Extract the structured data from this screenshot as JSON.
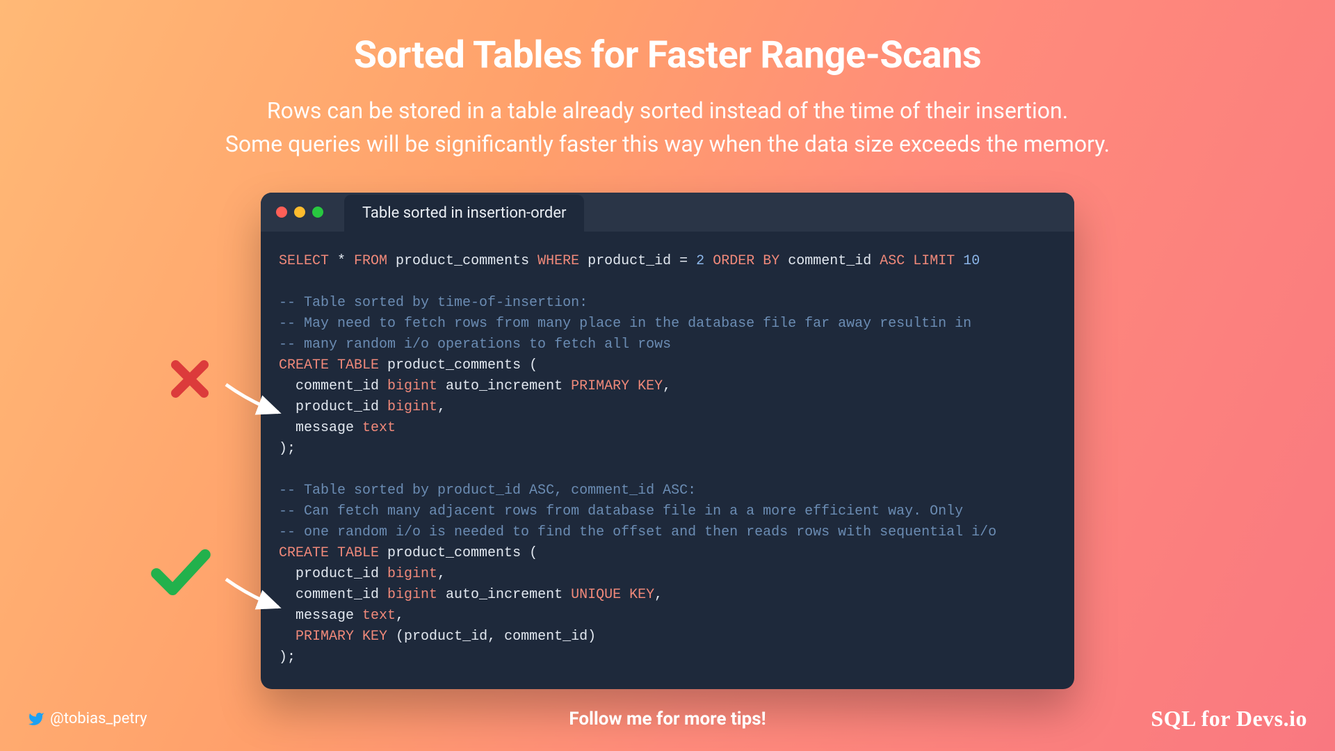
{
  "title": "Sorted Tables for Faster Range-Scans",
  "subtitle_line1": "Rows can be stored in a table already sorted instead of the time of their insertion.",
  "subtitle_line2": "Some queries will be significantly faster this way when the data size exceeds the memory.",
  "window": {
    "tab_label": "Table sorted in insertion-order"
  },
  "code": {
    "select": {
      "kw1": "SELECT",
      "star": " * ",
      "kw2": "FROM",
      "tbl": " product_comments ",
      "kw3": "WHERE",
      "col": " product_id ",
      "eq": "= ",
      "val": "2",
      "sp1": " ",
      "kw4": "ORDER BY",
      "col2": " comment_id ",
      "kw5": "ASC LIMIT",
      "sp2": " ",
      "lim": "10"
    },
    "block1": {
      "c1": "-- Table sorted by time-of-insertion:",
      "c2": "-- May need to fetch rows from many place in the database file far away resultin in",
      "c3": "-- many random i/o operations to fetch all rows",
      "kw_create": "CREATE TABLE",
      "tbl": " product_comments (",
      "l1a": "  comment_id ",
      "l1b": "bigint",
      "l1c": " auto_increment ",
      "l1d": "PRIMARY KEY",
      "l1e": ",",
      "l2a": "  product_id ",
      "l2b": "bigint",
      "l2c": ",",
      "l3a": "  message ",
      "l3b": "text",
      "close": ");"
    },
    "block2": {
      "c1": "-- Table sorted by product_id ASC, comment_id ASC:",
      "c2": "-- Can fetch many adjacent rows from database file in a a more efficient way. Only",
      "c3": "-- one random i/o is needed to find the offset and then reads rows with sequential i/o",
      "kw_create": "CREATE TABLE",
      "tbl": " product_comments (",
      "l1a": "  product_id ",
      "l1b": "bigint",
      "l1c": ",",
      "l2a": "  comment_id ",
      "l2b": "bigint",
      "l2c": " auto_increment ",
      "l2d": "UNIQUE KEY",
      "l2e": ",",
      "l3a": "  message ",
      "l3b": "text",
      "l3c": ",",
      "l4a": "  ",
      "l4b": "PRIMARY KEY",
      "l4c": " (product_id, comment_id)",
      "close": ");"
    }
  },
  "footer": {
    "handle": "@tobias_petry",
    "follow": "Follow me for more tips!",
    "brand": "SQL for Devs.io"
  }
}
